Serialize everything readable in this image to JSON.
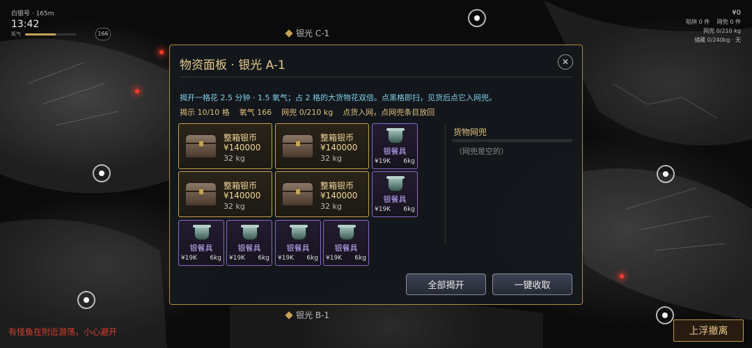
{
  "hud": {
    "ship_info": "白银号 · 165m",
    "time": "13:42",
    "oxygen_label": "氧气",
    "oxygen_fraction": 0.6,
    "depth_badge": "166",
    "money": "¥0",
    "stats_line1": "陷阱 0 件　 网兜 0 件",
    "stats_line2": "网兜 0/210 kg",
    "stats_line3": "储藏 0/240kg · 无"
  },
  "regions": {
    "top": "银光 C-1",
    "bottom": "银光 B-1"
  },
  "warning": "有怪鱼在附近游荡，小心避开",
  "ascend_button": "上浮撤离",
  "dialog": {
    "title": "物资面板 · 银光 A-1",
    "close_symbol": "✕",
    "description": "揭开一格花 2.5 分钟 · 1.5 氧气；占 2 格的大货物花双倍。点黑格即扫，见货后点它入网兜。",
    "stats": {
      "revealed": "揭示 10/10 格",
      "oxygen": "氧气 166",
      "net": "网兜 0/210 kg",
      "hint": "点货入网，点网兜条目放回"
    },
    "big_items": [
      {
        "name": "整箱银币",
        "value": "¥140000",
        "weight": "32 kg"
      },
      {
        "name": "整箱银币",
        "value": "¥140000",
        "weight": "32 kg"
      },
      {
        "name": "整箱银币",
        "value": "¥140000",
        "weight": "32 kg"
      },
      {
        "name": "整箱银币",
        "value": "¥140000",
        "weight": "32 kg"
      }
    ],
    "small_items": [
      {
        "name": "银餐具",
        "value": "¥19K",
        "weight": "6kg"
      },
      {
        "name": "银餐具",
        "value": "¥19K",
        "weight": "6kg"
      },
      {
        "name": "银餐具",
        "value": "¥19K",
        "weight": "6kg"
      },
      {
        "name": "银餐具",
        "value": "¥19K",
        "weight": "6kg"
      },
      {
        "name": "银餐具",
        "value": "¥19K",
        "weight": "6kg"
      },
      {
        "name": "银餐具",
        "value": "¥19K",
        "weight": "6kg"
      }
    ],
    "net_panel": {
      "title": "货物网兜",
      "fill_fraction": 0.0,
      "empty_text": "（网兜是空的）"
    },
    "buttons": {
      "reveal_all": "全部揭开",
      "collect_all": "一键收取"
    }
  },
  "colors": {
    "gold_border": "#c9a24e",
    "purple_border": "#8a6bc8",
    "desc_text": "#7fd0e8",
    "warning_red": "#d8402e"
  }
}
